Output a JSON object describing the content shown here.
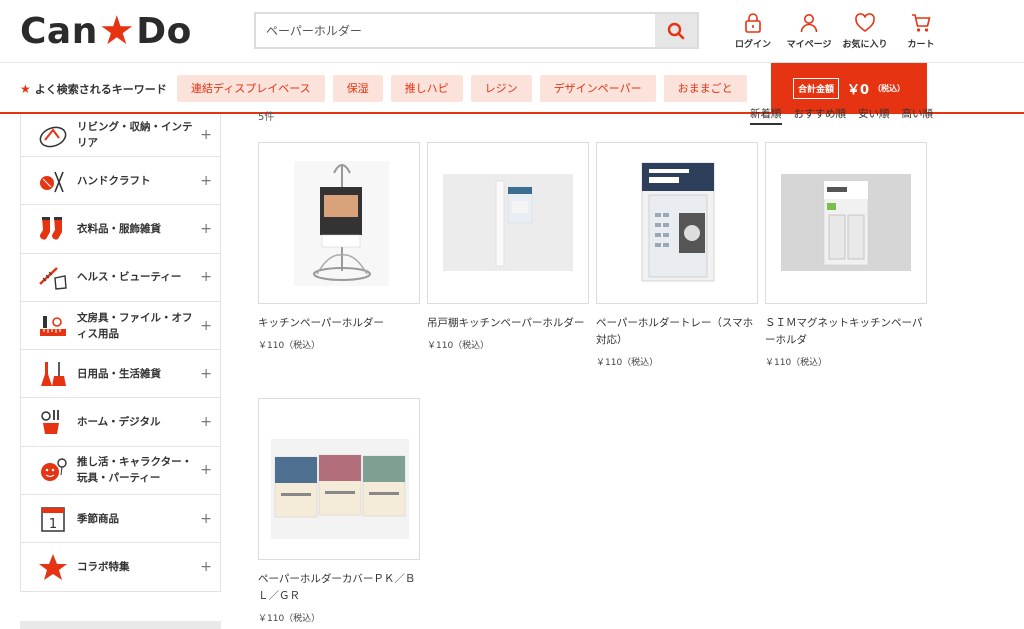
{
  "header": {
    "logo_left": "Can",
    "logo_star": "★",
    "logo_right": "Do",
    "search_value": "ペーパーホルダー",
    "nav": [
      {
        "label": "ログイン",
        "icon": "lock-icon"
      },
      {
        "label": "マイページ",
        "icon": "user-icon"
      },
      {
        "label": "お気に入り",
        "icon": "heart-icon"
      },
      {
        "label": "カート",
        "icon": "cart-icon"
      }
    ]
  },
  "keywords": {
    "star": "★",
    "title": "よく検索されるキーワード",
    "tags": [
      "連結ディスプレイベース",
      "保湿",
      "推しハピ",
      "レジン",
      "デザインペーパー",
      "おままごと"
    ]
  },
  "cart_total": {
    "label": "合計金額",
    "amount": "￥0",
    "tax": "（税込）"
  },
  "sidebar": {
    "plus": "+",
    "categories": [
      {
        "label": "リビング・収納・インテリア",
        "icon": "living-icon"
      },
      {
        "label": "ハンドクラフト",
        "icon": "handcraft-icon"
      },
      {
        "label": "衣料品・服飾雑貨",
        "icon": "socks-icon"
      },
      {
        "label": "ヘルス・ビューティー",
        "icon": "beauty-icon"
      },
      {
        "label": "文房具・ファイル・オフィス用品",
        "icon": "stationery-icon"
      },
      {
        "label": "日用品・生活雑貨",
        "icon": "daily-goods-icon"
      },
      {
        "label": "ホーム・デジタル",
        "icon": "home-digital-icon"
      },
      {
        "label": "推し活・キャラクター・玩具・パーティー",
        "icon": "party-icon"
      },
      {
        "label": "季節商品",
        "icon": "calendar-icon"
      },
      {
        "label": "コラボ特集",
        "icon": "star-icon"
      }
    ]
  },
  "results": {
    "count": "5件",
    "sort": [
      "新着順",
      "おすすめ順",
      "安い順",
      "高い順"
    ],
    "products": [
      {
        "name": "キッチンペーパーホルダー",
        "price": "￥110（税込）"
      },
      {
        "name": "吊戸棚キッチンペーパーホルダー",
        "price": "￥110（税込）"
      },
      {
        "name": "ペーパーホルダートレー（スマホ対応）",
        "price": "￥110（税込）"
      },
      {
        "name": "ＳＩＭマグネットキッチンペーパーホルダ",
        "price": "￥110（税込）"
      },
      {
        "name": "ペーパーホルダーカバーＰＫ／ＢＬ／ＧＲ",
        "price": "￥110（税込）"
      }
    ]
  },
  "colors": {
    "accent": "#e63312",
    "tag_bg": "#fbe3dc"
  }
}
